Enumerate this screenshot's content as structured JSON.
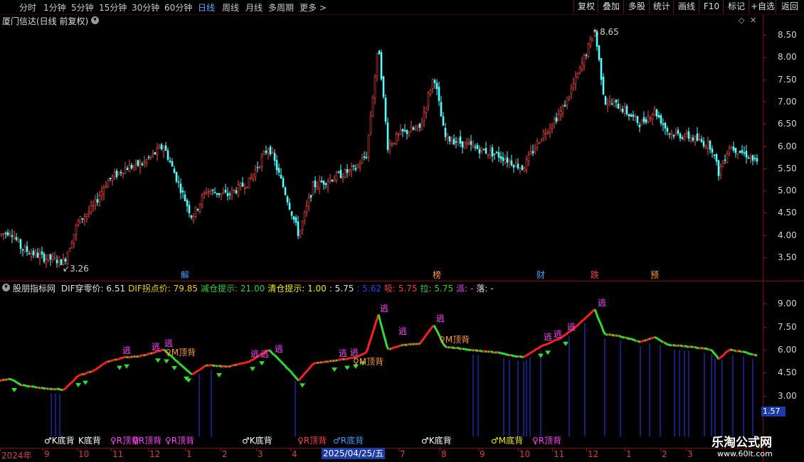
{
  "toolbar": {
    "periods": [
      "分时",
      "1分钟",
      "5分钟",
      "15分钟",
      "30分钟",
      "60分钟",
      "日线",
      "周线",
      "月线",
      "多周期",
      "更多 >"
    ],
    "active_period": "日线",
    "buttons": [
      "复权",
      "叠加",
      "多股",
      "统计",
      "画线",
      "F10",
      "标记",
      "+自选",
      "返回"
    ]
  },
  "main": {
    "title": "厦门信达(日线 前复权)",
    "price_axis": [
      "8.50",
      "8.00",
      "7.50",
      "7.00",
      "6.50",
      "6.00",
      "5.50",
      "5.00",
      "4.50",
      "4.00",
      "3.50"
    ],
    "high_label": "8.65",
    "low_label": "3.26",
    "events": [
      {
        "text": "解",
        "color": "#3aa0ff"
      },
      {
        "text": "榜",
        "color": "#ff9a30"
      },
      {
        "text": "财",
        "color": "#3aa0ff"
      },
      {
        "text": "跌",
        "color": "#ff4040"
      },
      {
        "text": "预",
        "color": "#ff9a30"
      }
    ]
  },
  "indicator": {
    "name": "股朋指标网",
    "fields": [
      {
        "text": "DIF穿零价: 6.51",
        "color": "#e0e0e0"
      },
      {
        "text": "DIF拐点价: 79.85",
        "color": "#f0d000"
      },
      {
        "text": "减仓提示: 21.00",
        "color": "#30d030"
      },
      {
        "text": "清仓提示: 1.00",
        "color": "#f0f000"
      },
      {
        "text": ": 5.75",
        "color": "#e0e0e0"
      },
      {
        "text": ": 5.62",
        "color": "#2040ff"
      },
      {
        "text": "吸: 5.75",
        "color": "#ff3030"
      },
      {
        "text": "拉: 5.75",
        "color": "#30d030"
      },
      {
        "text": "派: -",
        "color": "#ff40ff"
      },
      {
        "text": "落: -",
        "color": "#e0e0e0"
      }
    ],
    "axis": [
      "9.00",
      "7.50",
      "6.00",
      "4.50",
      "3.00"
    ],
    "value_box": "1.57",
    "escape_label": "逃",
    "top_signals": [
      "♀M顶背",
      "♀M顶背"
    ]
  },
  "bottom_signals": [
    {
      "text": "♂K底背",
      "color": "#ffffff"
    },
    {
      "text": "K底背",
      "color": "#ffffff"
    },
    {
      "text": "♀R顶背",
      "color": "#ff40ff"
    },
    {
      "text": "♀R顶背",
      "color": "#ff40ff"
    },
    {
      "text": "♀R顶背",
      "color": "#ff40ff"
    },
    {
      "text": "♂K底背",
      "color": "#ffffff"
    },
    {
      "text": "♀R顶背",
      "color": "#ff4040"
    },
    {
      "text": "♂R底背",
      "color": "#3aa0ff"
    },
    {
      "text": "♂K底背",
      "color": "#ffffff"
    },
    {
      "text": "♂M底背",
      "color": "#f0f000"
    },
    {
      "text": "♀R顶背",
      "color": "#ff40ff"
    }
  ],
  "date_axis": {
    "labels": [
      "2024年",
      "9",
      "10",
      "11",
      "12",
      "1",
      "2",
      "3",
      "4",
      "7",
      "8",
      "9",
      "10",
      "11",
      "12",
      "1",
      "2",
      "3"
    ],
    "cursor_date": "2025/04/25/五"
  },
  "watermark": {
    "title": "乐淘公式网",
    "url": "www.60lt.com"
  }
}
